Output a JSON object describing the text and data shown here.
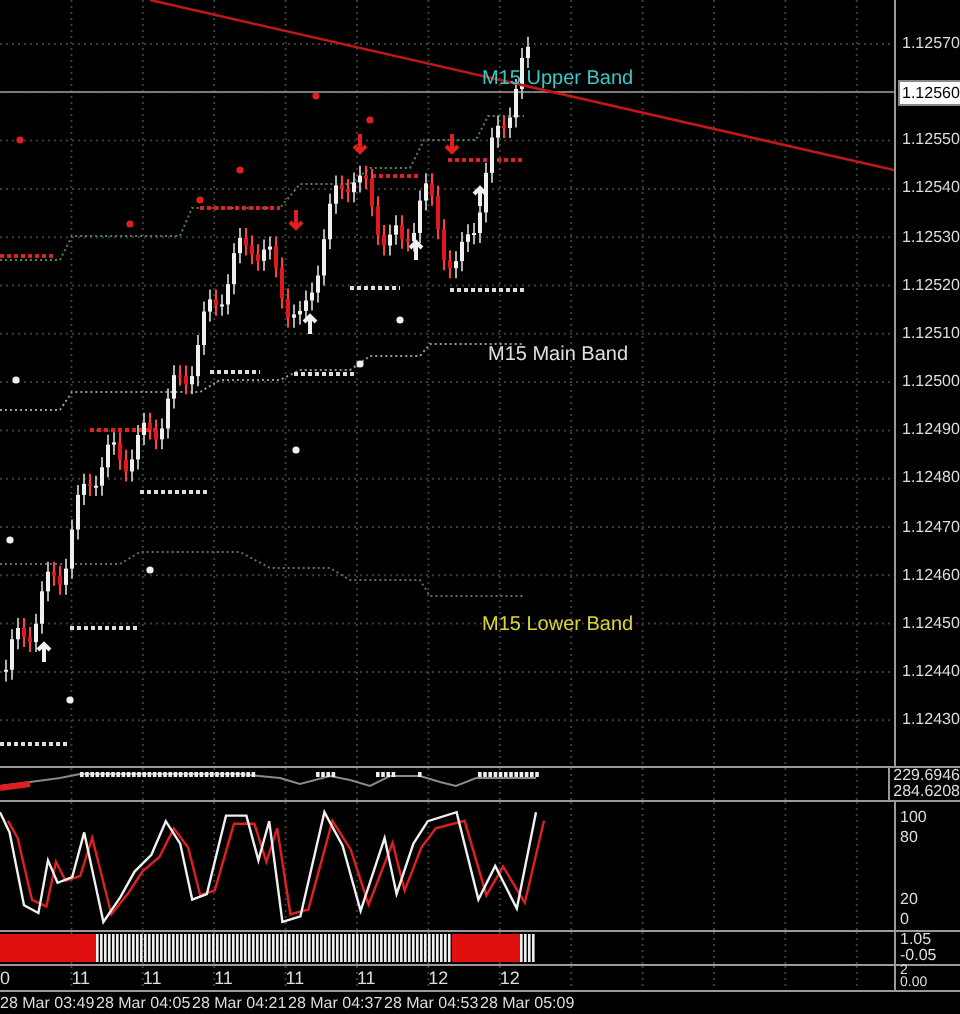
{
  "price_axis": {
    "labels": [
      {
        "text": "1.12570",
        "kind": "tick"
      },
      {
        "text": "1.12560",
        "kind": "current"
      },
      {
        "text": "1.12550",
        "kind": "tick"
      },
      {
        "text": "1.12540",
        "kind": "tick"
      },
      {
        "text": "1.12530",
        "kind": "tick"
      },
      {
        "text": "1.12520",
        "kind": "tick"
      },
      {
        "text": "1.12510",
        "kind": "tick"
      },
      {
        "text": "1.12500",
        "kind": "tick"
      },
      {
        "text": "1.12490",
        "kind": "tick"
      },
      {
        "text": "1.12480",
        "kind": "tick"
      },
      {
        "text": "1.12470",
        "kind": "tick"
      },
      {
        "text": "1.12460",
        "kind": "tick"
      },
      {
        "text": "1.12450",
        "kind": "tick"
      },
      {
        "text": "1.12440",
        "kind": "tick"
      },
      {
        "text": "1.12430",
        "kind": "tick"
      }
    ]
  },
  "band_labels": [
    {
      "text": "M15 Upper Band",
      "color": "#3cc8c8"
    },
    {
      "text": "M15 Main Band",
      "color": "#e0e0e0"
    },
    {
      "text": "M15 Lower Band",
      "color": "#d8d830"
    }
  ],
  "indicator_panels": [
    {
      "scale": [
        "229.6946",
        "284.6208"
      ]
    },
    {
      "scale": [
        "100",
        "80",
        "20",
        "0"
      ]
    },
    {
      "scale": [
        "1.05",
        "-0.05"
      ]
    },
    {
      "scale": [
        "2",
        "0.00"
      ],
      "counters": [
        "0",
        "11",
        "11",
        "11",
        "11",
        "11",
        "12",
        "12"
      ]
    }
  ],
  "time_axis": {
    "labels": [
      "28 Mar 03:49",
      "28 Mar 04:05",
      "28 Mar 04:21",
      "28 Mar 04:37",
      "28 Mar 04:53",
      "28 Mar 05:09"
    ]
  }
}
